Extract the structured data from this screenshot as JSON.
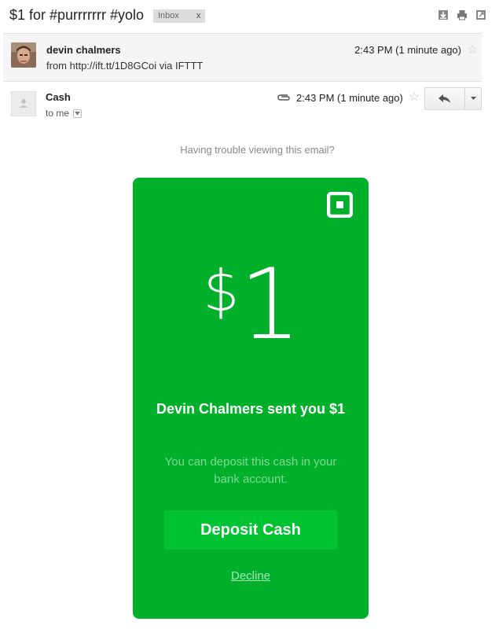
{
  "thread": {
    "subject": "$1 for #purrrrrrr #yolo",
    "label": "Inbox",
    "label_remove": "x"
  },
  "toolbar_icons": [
    "download-icon",
    "print-icon",
    "new-window-icon"
  ],
  "message1": {
    "sender": "devin chalmers",
    "from_line": "from http://ift.tt/1D8GCoi via IFTTT",
    "time": "2:43 PM (1 minute ago)"
  },
  "message2": {
    "sender": "Cash",
    "recipient": "to me",
    "time": "2:43 PM (1 minute ago)"
  },
  "email_body": {
    "trouble_text": "Having trouble viewing this email?",
    "currency": "$",
    "amount": "1",
    "headline": "Devin Chalmers sent you $1",
    "subtext": "You can deposit this cash in your bank account.",
    "deposit_label": "Deposit Cash",
    "decline_label": "Decline"
  },
  "colors": {
    "card": "#00b02a",
    "deposit_button": "#00c332",
    "subtext": "#7fd895"
  }
}
